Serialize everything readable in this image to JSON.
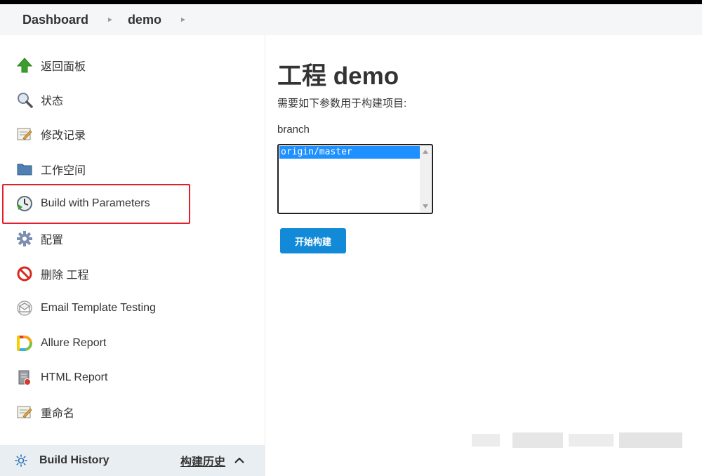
{
  "breadcrumb": {
    "items": [
      "Dashboard",
      "demo"
    ]
  },
  "sidebar": {
    "items": [
      {
        "label": "返回面板",
        "icon": "up-arrow-icon"
      },
      {
        "label": "状态",
        "icon": "magnifier-icon"
      },
      {
        "label": "修改记录",
        "icon": "notepad-icon"
      },
      {
        "label": "工作空间",
        "icon": "folder-icon"
      },
      {
        "label": "Build with Parameters",
        "icon": "clock-play-icon"
      },
      {
        "label": "配置",
        "icon": "gear-icon"
      },
      {
        "label": "删除 工程",
        "icon": "no-entry-icon"
      },
      {
        "label": "Email Template Testing",
        "icon": "envelope-icon"
      },
      {
        "label": "Allure Report",
        "icon": "allure-logo-icon"
      },
      {
        "label": "HTML Report",
        "icon": "html-report-icon"
      },
      {
        "label": "重命名",
        "icon": "rename-icon"
      }
    ],
    "highlighted_item": "Build with Parameters",
    "highlight_color": "#e0202b"
  },
  "build_history": {
    "label": "Build History",
    "trend_label": "构建历史"
  },
  "main": {
    "title": "工程 demo",
    "description": "需要如下参数用于构建项目:",
    "parameter": {
      "name": "branch",
      "options": [
        "origin/master"
      ],
      "selected": "origin/master"
    },
    "build_button": "开始构建"
  },
  "colors": {
    "accent": "#138ad7",
    "selection": "#1e90ff",
    "breadcrumb_bg": "#f5f6f7",
    "build_history_bg": "#e9eef2"
  }
}
